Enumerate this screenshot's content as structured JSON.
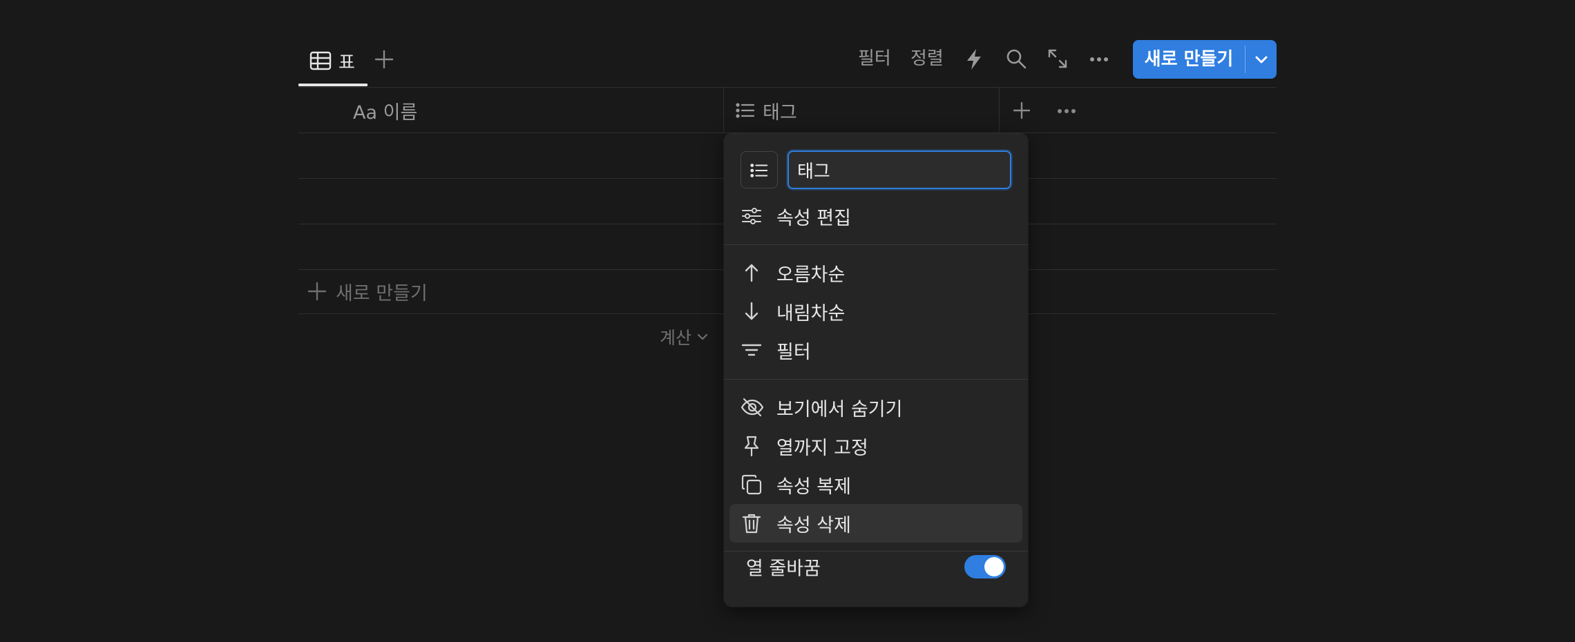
{
  "toolbar": {
    "active_tab_label": "표",
    "filter_label": "필터",
    "sort_label": "정렬",
    "new_button_label": "새로 만들기"
  },
  "table": {
    "columns": [
      {
        "label": "Aa 이름",
        "icon": "text-icon"
      },
      {
        "label": "태그",
        "icon": "list-icon"
      }
    ],
    "new_row_label": "새로 만들기",
    "calc_label": "계산"
  },
  "menu": {
    "property_name": "태그",
    "items": [
      {
        "label": "속성 편집",
        "icon": "sliders-icon"
      },
      {
        "label": "오름차순",
        "icon": "arrow-up-icon"
      },
      {
        "label": "내림차순",
        "icon": "arrow-down-icon"
      },
      {
        "label": "필터",
        "icon": "filter-icon"
      },
      {
        "label": "보기에서 숨기기",
        "icon": "eye-off-icon"
      },
      {
        "label": "열까지 고정",
        "icon": "pin-icon"
      },
      {
        "label": "속성 복제",
        "icon": "duplicate-icon"
      },
      {
        "label": "속성 삭제",
        "icon": "trash-icon"
      }
    ],
    "wrap_label": "열 줄바꿈",
    "wrap_enabled": true
  },
  "colors": {
    "background": "#191919",
    "accent": "#2f7ee0",
    "menu_bg": "#252525"
  }
}
